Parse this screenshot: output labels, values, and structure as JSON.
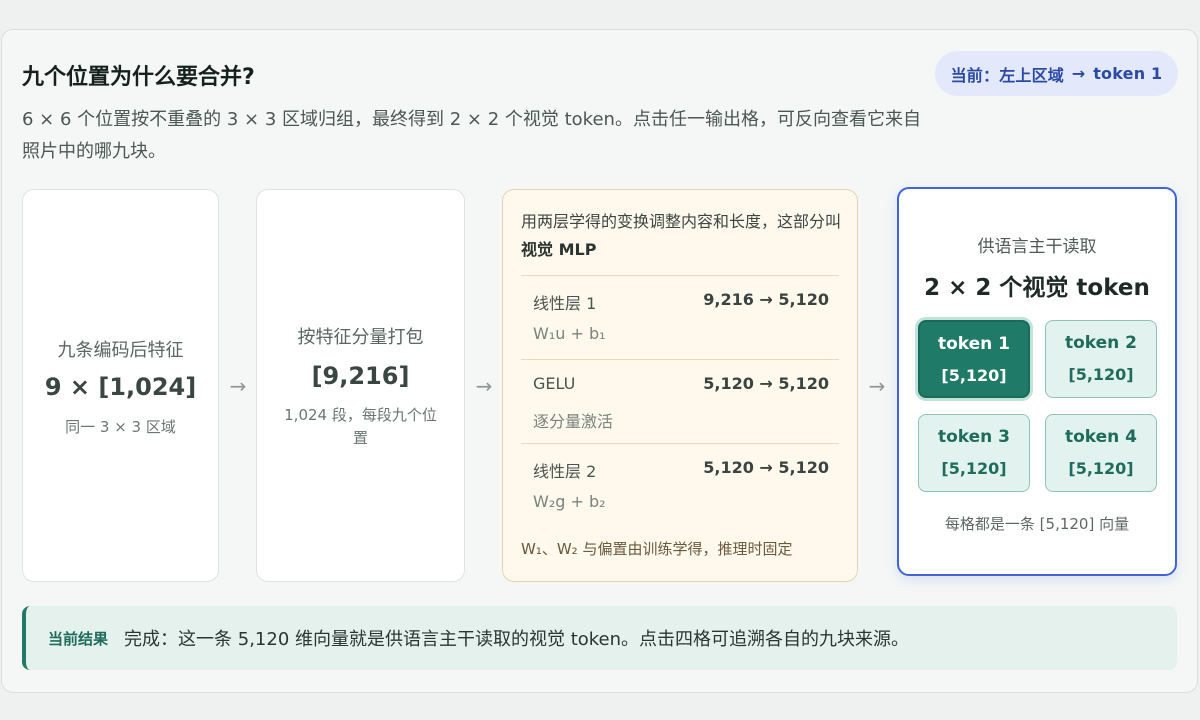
{
  "header": {
    "title": "九个位置为什么要合并?",
    "badge_prefix": "当前：",
    "badge_region": "左上区域",
    "badge_arrow": "→",
    "badge_token": "token 1",
    "description": "6 × 6 个位置按不重叠的 3 × 3 区域归组，最终得到 2 × 2 个视觉 token。点击任一输出格，可反向查看它来自照片中的哪九块。"
  },
  "stage1": {
    "label": "九条编码后特征",
    "value": "9 × [1,024]",
    "sub": "同一 3 × 3 区域"
  },
  "stage2": {
    "label": "按特征分量打包",
    "value": "[9,216]",
    "sub": "1,024 段，每段九个位置"
  },
  "arrows": {
    "symbol": "→"
  },
  "mlp": {
    "intro_text": "用两层学得的变换调整内容和长度，这部分叫",
    "intro_bold": "视觉 MLP",
    "layers": [
      {
        "name": "线性层 1",
        "dims": "9,216 → 5,120",
        "formula": "W₁u + b₁"
      },
      {
        "name": "GELU",
        "dims": "5,120 → 5,120",
        "formula": "逐分量激活"
      },
      {
        "name": "线性层 2",
        "dims": "5,120 → 5,120",
        "formula": "W₂g + b₂"
      }
    ],
    "footer": "W₁、W₂ 与偏置由训练学得，推理时固定"
  },
  "output": {
    "heading": "供语言主干读取",
    "title": "2 × 2 个视觉 token",
    "tokens": [
      {
        "name": "token 1",
        "dim": "[5,120]",
        "active": true
      },
      {
        "name": "token 2",
        "dim": "[5,120]",
        "active": false
      },
      {
        "name": "token 3",
        "dim": "[5,120]",
        "active": false
      },
      {
        "name": "token 4",
        "dim": "[5,120]",
        "active": false
      }
    ],
    "footer": "每格都是一条 [5,120] 向量"
  },
  "result": {
    "label": "当前结果",
    "text": "完成：这一条 5,120 维向量就是供语言主干读取的视觉 token。点击四格可追溯各自的九块来源。"
  },
  "colors": {
    "accent_blue": "#3e63dd",
    "accent_green": "#1f7a67",
    "mlp_bg": "#fff8ec"
  }
}
